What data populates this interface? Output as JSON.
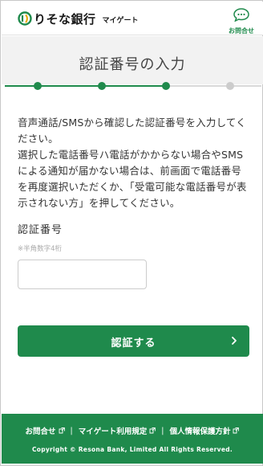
{
  "header": {
    "brand": "りそな銀行",
    "sub_brand": "マイゲート",
    "contact_label": "お問合せ"
  },
  "page": {
    "title": "認証番号の入力",
    "steps_total": 4,
    "current_step": 3
  },
  "instructions": {
    "line1": "音声通話/SMSから確認した認証番号を入力してください。",
    "line2": "選択した電話番号ハ電話がかからない場合やSMSによる通知が届かない場合は、前画面で電話番号を再度選択いただくか、「受電可能な電話番号が表示されない方」を押してください。"
  },
  "form": {
    "field_label": "認証番号",
    "field_hint": "※半角数字4桁",
    "code_value": "",
    "submit_label": "認証する"
  },
  "footer": {
    "links": [
      "お問合せ",
      "マイゲート利用規定",
      "個人情報保護方針"
    ],
    "separator": "|",
    "copyright": "Copyright © Resona Bank, Limited All Rights Reserved."
  },
  "colors": {
    "brand_green": "#1f8a4c",
    "step_inactive": "#cccccc"
  },
  "icons": {
    "contact": "chat-bubble-icon",
    "submit": "chevron-right-icon",
    "external": "external-link-icon",
    "logo": "resona-logo-icon"
  }
}
